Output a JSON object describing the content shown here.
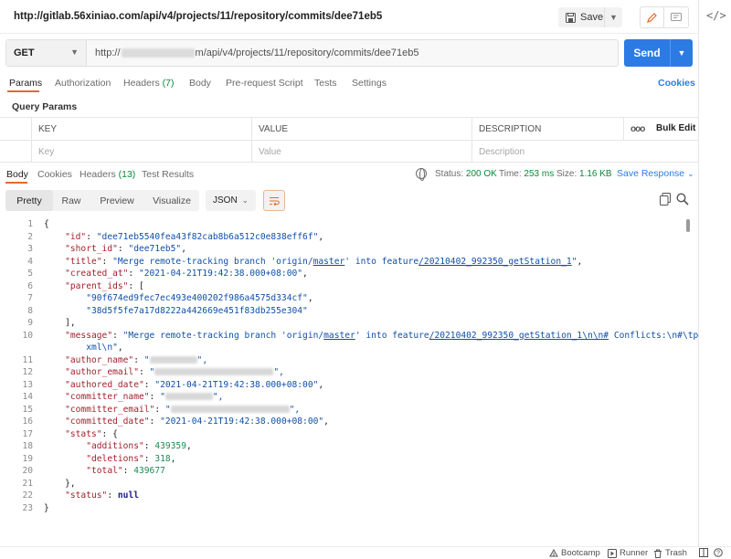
{
  "title_bar": {
    "request_title": "http://gitlab.56xiniao.com/api/v4/projects/11/repository/commits/dee71eb5",
    "save_label": "Save"
  },
  "url_bar": {
    "method": "GET",
    "url_prefix": "http://",
    "url_suffix": "m/api/v4/projects/11/repository/commits/dee71eb5",
    "send_label": "Send"
  },
  "request_tabs": [
    {
      "label": "Params",
      "count": ""
    },
    {
      "label": "Authorization",
      "count": ""
    },
    {
      "label": "Headers",
      "count": "(7)"
    },
    {
      "label": "Body",
      "count": ""
    },
    {
      "label": "Pre-request Script",
      "count": ""
    },
    {
      "label": "Tests",
      "count": ""
    },
    {
      "label": "Settings",
      "count": ""
    }
  ],
  "cookies_link": "Cookies",
  "query_params": {
    "title": "Query Params",
    "columns": [
      "KEY",
      "VALUE",
      "DESCRIPTION"
    ],
    "bulk_edit": "Bulk Edit",
    "more": "ooo",
    "placeholders": [
      "Key",
      "Value",
      "Description"
    ]
  },
  "response_tabs": [
    {
      "label": "Body",
      "count": ""
    },
    {
      "label": "Cookies",
      "count": ""
    },
    {
      "label": "Headers",
      "count": "(13)"
    },
    {
      "label": "Test Results",
      "count": ""
    }
  ],
  "response_status": {
    "status_label": "Status:",
    "status_value": "200 OK",
    "time_label": "Time:",
    "time_value": "253 ms",
    "size_label": "Size:",
    "size_value": "1.16 KB",
    "save_response": "Save Response"
  },
  "view_modes": [
    "Pretty",
    "Raw",
    "Preview",
    "Visualize"
  ],
  "format": "JSON",
  "code_lines": [
    {
      "n": "1"
    },
    {
      "n": "2"
    },
    {
      "n": "3"
    },
    {
      "n": "4"
    },
    {
      "n": "5"
    },
    {
      "n": "6"
    },
    {
      "n": "7"
    },
    {
      "n": "8"
    },
    {
      "n": "9"
    },
    {
      "n": "10"
    },
    {
      "n": "11"
    },
    {
      "n": "12"
    },
    {
      "n": "13"
    },
    {
      "n": "14"
    },
    {
      "n": "15"
    },
    {
      "n": "16"
    },
    {
      "n": "17"
    },
    {
      "n": "18"
    },
    {
      "n": "19"
    },
    {
      "n": "20"
    },
    {
      "n": "21"
    },
    {
      "n": "22"
    },
    {
      "n": "23"
    }
  ],
  "json": {
    "open": "{",
    "id_key": "\"id\"",
    "id_val": "\"dee71eb5540fea43f82cab8b6a512c0e838eff6f\"",
    "short_id_key": "\"short_id\"",
    "short_id_val": "\"dee71eb5\"",
    "title_key": "\"title\"",
    "title_val_a": "\"Merge remote-tracking branch 'origin/",
    "title_val_b": "master",
    "title_val_c": "' into feature",
    "title_val_d": "/20210402_992350_getStation_1",
    "title_val_e": "\"",
    "created_key": "\"created_at\"",
    "created_val": "\"2021-04-21T19:42:38.000+08:00\"",
    "parent_key": "\"parent_ids\"",
    "parent_1": "\"90f674ed9fec7ec493e400202f986a4575d334cf\"",
    "parent_2": "\"38d5f5fe7a17d8222a442669e451f83db255e304\"",
    "message_key": "\"message\"",
    "message_a": "\"Merge remote-tracking branch 'origin/",
    "message_b": "master",
    "message_c": "' into feature",
    "message_d": "/20210402_992350_getStation_1\\n\\n#",
    "message_e": " Conflicts:\\n#\\tpom.",
    "message_f": "xml\\n\"",
    "author_name_key": "\"author_name\"",
    "author_email_key": "\"author_email\"",
    "authored_key": "\"authored_date\"",
    "authored_val": "\"2021-04-21T19:42:38.000+08:00\"",
    "committer_name_key": "\"committer_name\"",
    "committer_email_key": "\"committer_email\"",
    "committed_key": "\"committed_date\"",
    "committed_val": "\"2021-04-21T19:42:38.000+08:00\"",
    "stats_key": "\"stats\"",
    "additions_key": "\"additions\"",
    "additions_val": "439359",
    "deletions_key": "\"deletions\"",
    "deletions_val": "318",
    "total_key": "\"total\"",
    "total_val": "439677",
    "status_key": "\"status\"",
    "status_val": "null",
    "close": "}"
  },
  "status_bar": {
    "bootcamp": "Bootcamp",
    "runner": "Runner",
    "trash": "Trash"
  }
}
